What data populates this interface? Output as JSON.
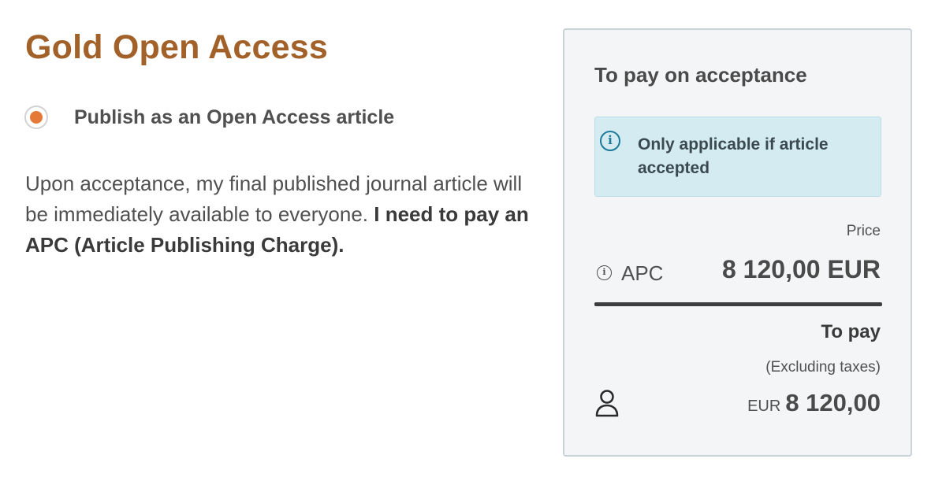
{
  "section": {
    "title": "Gold Open Access",
    "option_label": "Publish as an Open Access article",
    "option_selected": true,
    "description_regular": "Upon acceptance, my final published journal article will be immediately available to everyone.",
    "description_bold": "I need to pay an APC (Article Publishing Charge)."
  },
  "panel": {
    "title": "To pay on acceptance",
    "info_icon": "info-circle-icon",
    "info_text": "Only applicable if article accepted",
    "price_header": "Price",
    "apc_label": "APC",
    "apc_price": "8 120,00 EUR",
    "to_pay_label": "To pay",
    "excluding_taxes": "(Excluding taxes)",
    "total_currency": "EUR",
    "total_amount": "8 120,00",
    "user_icon": "user-icon"
  },
  "colors": {
    "title": "#a3612a",
    "radio_accent": "#e57a38",
    "info_background": "#d4ecf1",
    "info_icon": "#1e7a9a",
    "panel_background": "#f4f5f6"
  }
}
